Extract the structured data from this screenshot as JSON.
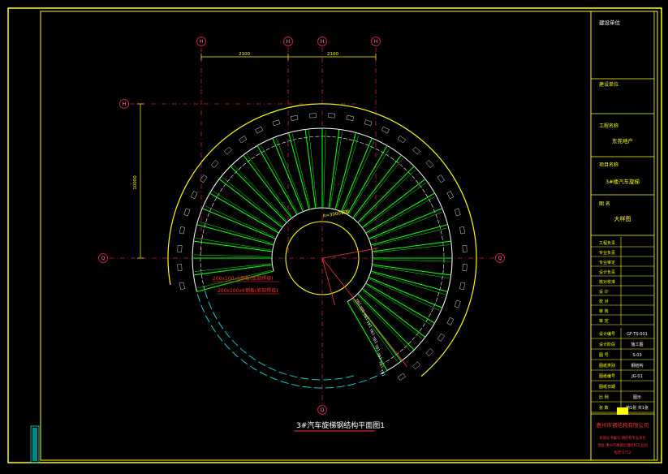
{
  "drawing": {
    "title": "3#汽车旋梯钢结构平面图1",
    "grid_labels": [
      "H",
      "H",
      "H",
      "H",
      "H",
      "Q",
      "Q",
      "Q"
    ],
    "dims_top": [
      "2100",
      "2100"
    ],
    "dim_left": "10000",
    "annotations": [
      "200x100x6钢板(底部焊接)",
      "200x100x6钢板(底部焊接)"
    ],
    "center_note": "R=3000钢板",
    "tread_labels": [
      "TB1",
      "TB1",
      "TB1",
      "TB1",
      "TB1",
      "TB1",
      "TB1",
      "TB1",
      "TB1",
      "TB1"
    ]
  },
  "title_block": {
    "header": "建设单位",
    "design_unit": "建设单位",
    "project_name_label": "工程名称",
    "project_name": "东莞地产",
    "item_name_label": "项目名称",
    "item_name": "3#楼汽车旋梯",
    "drawing_label": "图 名",
    "drawing_name": "大样图",
    "signature_rows": [
      "工程负责",
      "专业负责",
      "专业审定",
      "设计负责",
      "核对校准",
      "设 计",
      "校 对",
      "审 核",
      "审 定"
    ],
    "info_rows": [
      {
        "label": "设计编号",
        "value": "GF-TS-001"
      },
      {
        "label": "设计阶段",
        "value": "施工图"
      },
      {
        "label": "图 号",
        "value": "S-03"
      },
      {
        "label": "图纸类别",
        "value": "钢结构"
      },
      {
        "label": "图纸编号",
        "value": "JG-01"
      },
      {
        "label": "图纸日期",
        "value": ""
      },
      {
        "label": "比 例",
        "value": "图示"
      },
      {
        "label": "张 数",
        "value": "第1张 共1张"
      }
    ],
    "company": "惠州市钢结构有限公司",
    "company_sub1": "资质证书编号:钢结构专业承包",
    "company_sub2": "地址:惠州市惠城区钢结构工业园",
    "company_sub3": "电话:0752"
  },
  "colors": {
    "frame": "#ffff00",
    "grid": "#d4145a",
    "tread": "#00ff00",
    "arc_inner": "#ffffff",
    "dashed": "#00e5e5",
    "text": "#ffff00",
    "red": "#ff3030",
    "logo": "#ffff00"
  }
}
